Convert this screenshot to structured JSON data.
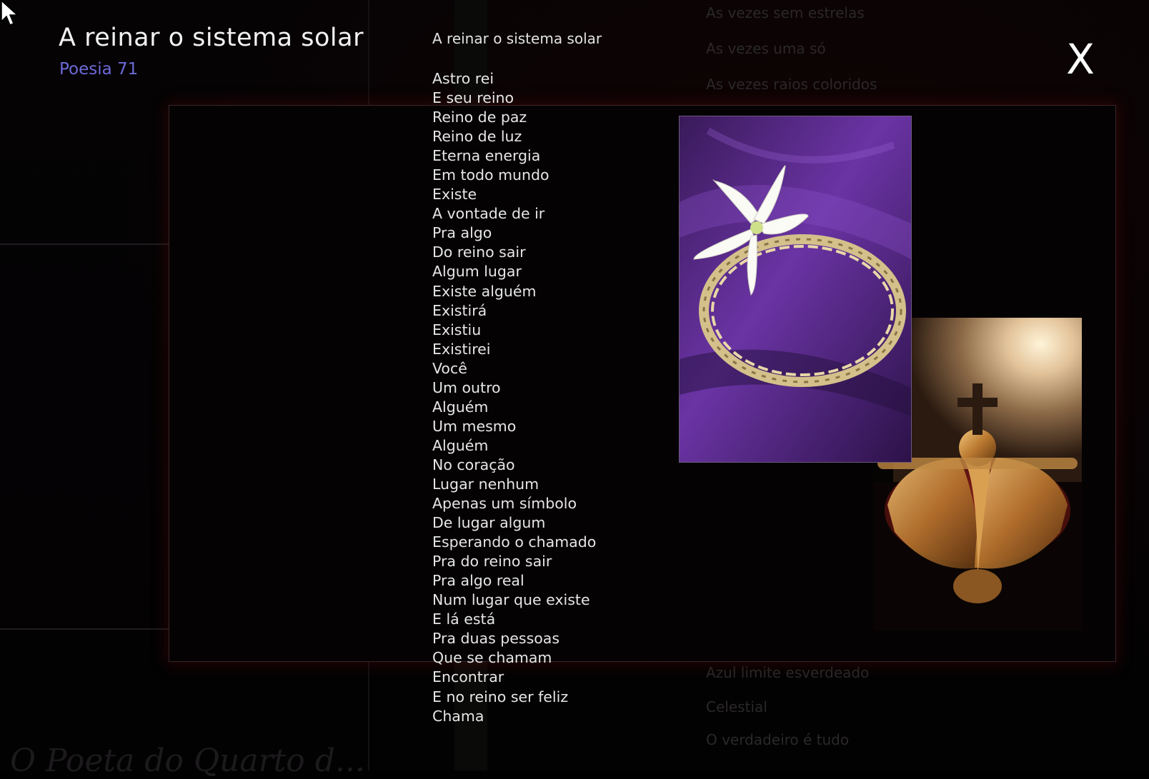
{
  "modal": {
    "title": "A reinar o sistema solar",
    "subtitle": "Poesia 71",
    "close_label": "X"
  },
  "poem": {
    "heading": "A reinar o sistema solar",
    "lines": [
      "Astro rei",
      "E seu reino",
      "Reino de paz",
      "Reino de luz",
      "Eterna energia",
      "Em todo mundo",
      "Existe",
      "A vontade de ir",
      "Pra algo",
      "Do reino sair",
      "Algum lugar",
      "Existe alguém",
      "Existirá",
      "Existiu",
      "Existirei",
      "Você",
      "Um outro",
      "Alguém",
      "Um mesmo",
      "Alguém",
      "No coração",
      "Lugar nenhum",
      "Apenas um símbolo",
      "De lugar algum",
      "Esperando o chamado",
      "Pra do reino sair",
      "Pra algo real",
      "Num lugar que existe",
      "E lá está",
      "Pra duas pessoas",
      "Que se chamam",
      "Encontrar",
      "E no reino ser feliz",
      "Chama"
    ]
  },
  "background": {
    "top_lines": [
      "As vezes sem estrelas",
      "As vezes uma só",
      "As vezes raios coloridos"
    ],
    "bottom_lines": [
      "Azul limite esverdeado",
      "Celestial",
      "O verdadeiro é tudo"
    ],
    "script_text": "O Poeta do Quarto d..."
  },
  "colors": {
    "subtitle": "#6d6ad8",
    "panel_border": "#3a2628",
    "text": "#e6e6e6"
  }
}
